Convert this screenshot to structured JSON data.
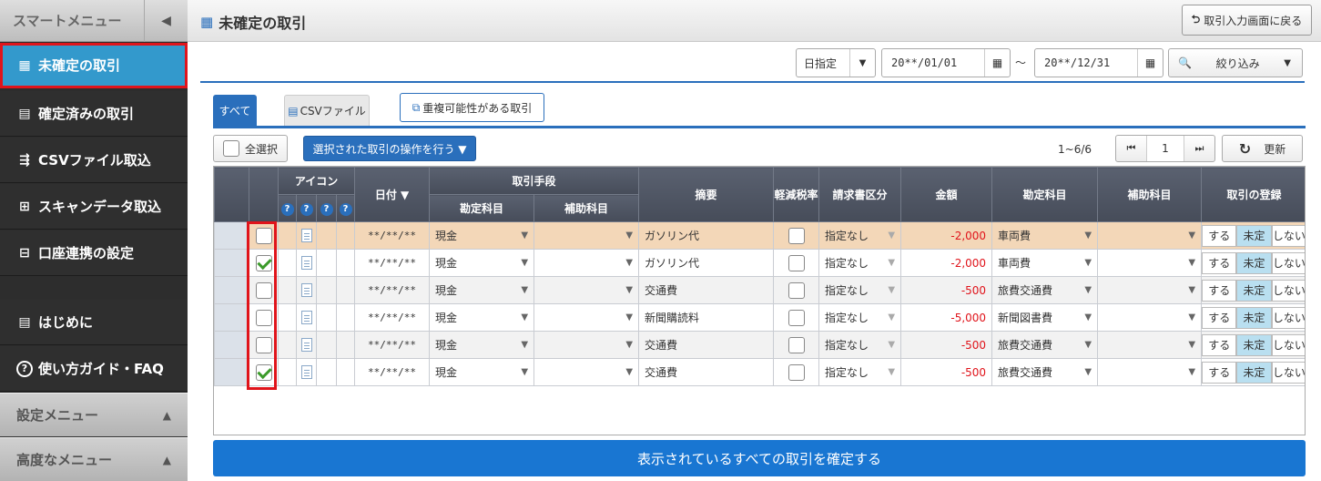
{
  "sidebar": {
    "header": "スマートメニュー",
    "collapse_icon": "◀",
    "items": [
      {
        "label": "未確定の取引",
        "icon": "▦"
      },
      {
        "label": "確定済みの取引",
        "icon": "▤"
      },
      {
        "label": "CSVファイル取込",
        "icon": "⇶"
      },
      {
        "label": "スキャンデータ取込",
        "icon": "⊞"
      },
      {
        "label": "口座連携の設定",
        "icon": "⊟"
      },
      {
        "label": "はじめに",
        "icon": "▤"
      },
      {
        "label": "使い方ガイド・FAQ",
        "icon": "?"
      }
    ],
    "sections": [
      {
        "label": "設定メニュー",
        "arrow": "▲"
      },
      {
        "label": "高度なメニュー",
        "arrow": "▲"
      }
    ]
  },
  "topbar": {
    "title": "未確定の取引",
    "title_icon": "▦",
    "back_label": "取引入力画面に戻る",
    "back_icon": "⮌"
  },
  "filter": {
    "mode": "日指定",
    "date_from": "20**/01/01",
    "tilde": "～",
    "date_to": "20**/12/31",
    "search_label": "絞り込み",
    "calendar_icon": "▦",
    "dropdown_icon": "▼",
    "search_icon": "🔍"
  },
  "tabs": {
    "all": "すべて",
    "csv": "CSVファイル",
    "csv_icon": "▤",
    "dup": "重複可能性がある取引",
    "dup_icon": "⧉"
  },
  "toolbar": {
    "select_all": "全選択",
    "operate": "選択された取引の操作を行う ▼",
    "range": "1~6/6",
    "page": "1",
    "refresh": "更新",
    "refresh_icon": "↻",
    "first_icon": "⏮",
    "last_icon": "⏭"
  },
  "table": {
    "headers": {
      "icon": "アイコン",
      "date": "日付 ▼",
      "payment": "取引手段",
      "account": "勘定科目",
      "sub_account": "補助科目",
      "summary": "摘要",
      "reduced_tax": "軽減税率",
      "invoice": "請求書区分",
      "amount": "金額",
      "account2": "勘定科目",
      "sub_account2": "補助科目",
      "register": "取引の登録",
      "q": "?"
    },
    "reg_labels": {
      "yes": "する",
      "pending": "未定",
      "no": "しない"
    },
    "rows": [
      {
        "checked": false,
        "date": "**/**/**",
        "pay": "現金",
        "summary": "ガソリン代",
        "invoice": "指定なし",
        "amount": "-2,000",
        "account": "車両費"
      },
      {
        "checked": true,
        "date": "**/**/**",
        "pay": "現金",
        "summary": "ガソリン代",
        "invoice": "指定なし",
        "amount": "-2,000",
        "account": "車両費"
      },
      {
        "checked": false,
        "date": "**/**/**",
        "pay": "現金",
        "summary": "交通費",
        "invoice": "指定なし",
        "amount": "-500",
        "account": "旅費交通費"
      },
      {
        "checked": false,
        "date": "**/**/**",
        "pay": "現金",
        "summary": "新聞購読料",
        "invoice": "指定なし",
        "amount": "-5,000",
        "account": "新聞図書費"
      },
      {
        "checked": false,
        "date": "**/**/**",
        "pay": "現金",
        "summary": "交通費",
        "invoice": "指定なし",
        "amount": "-500",
        "account": "旅費交通費"
      },
      {
        "checked": true,
        "date": "**/**/**",
        "pay": "現金",
        "summary": "交通費",
        "invoice": "指定なし",
        "amount": "-500",
        "account": "旅費交通費"
      }
    ]
  },
  "confirm_label": "表示されているすべての取引を確定する"
}
